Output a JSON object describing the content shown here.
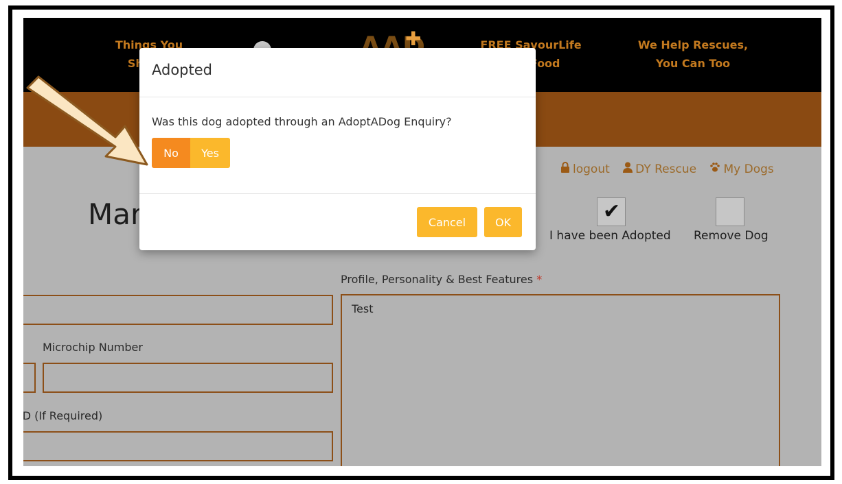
{
  "header": {
    "nav_left_line1": "Things You",
    "nav_left_line2": "Should",
    "logo_text": "AAD",
    "logo_cross": "✚",
    "nav_mid_line1": "FREE SavourLife",
    "nav_mid_line2": "Dog Food",
    "nav_right_line1": "We Help Rescues,",
    "nav_right_line2": "You Can Too"
  },
  "user_links": {
    "logout": "logout",
    "account": "DY Rescue",
    "my_dogs": "My Dogs"
  },
  "page": {
    "title": "Manage"
  },
  "checkboxes": {
    "adopted_label": "I have been Adopted",
    "adopted_checked": true,
    "remove_label": "Remove Dog",
    "remove_checked": false
  },
  "form": {
    "profile_label": "Profile, Personality & Best Features",
    "profile_required_mark": "*",
    "profile_value": "Test",
    "microchip_label": "Microchip Number",
    "microchip_value": "",
    "id_label": "ID (If Required)",
    "id_value": ""
  },
  "modal": {
    "title": "Adopted",
    "question": "Was this dog adopted through an AdoptADog Enquiry?",
    "option_no": "No",
    "option_yes": "Yes",
    "cancel_label": "Cancel",
    "ok_label": "OK"
  },
  "colors": {
    "accent_orange": "#f58a1f",
    "accent_yellow": "#fbb82c",
    "header_black": "#000000",
    "field_border": "#8c4f18"
  },
  "icons": {
    "logout": "lock-icon",
    "account": "user-icon",
    "my_dogs": "paw-icon",
    "pointer": "arrow-annotation-icon"
  }
}
